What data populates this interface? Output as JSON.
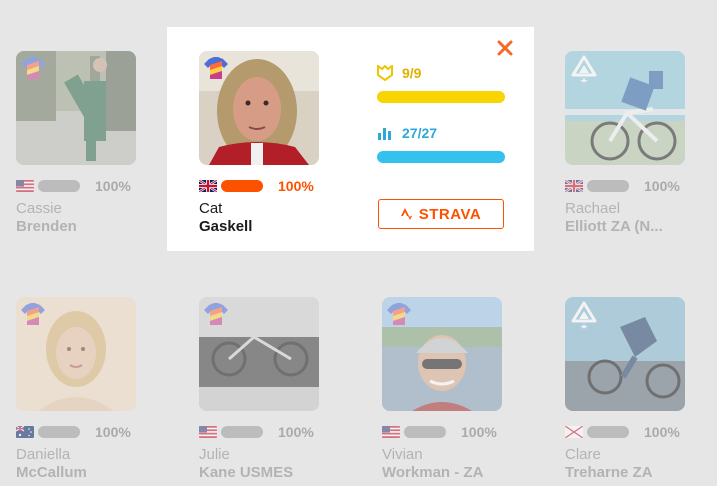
{
  "riders": [
    {
      "first": "Cassie",
      "last": "Brenden",
      "pct": "100%",
      "flag": "us-flag-icon",
      "badge": "jersey"
    },
    {
      "first": "Cat",
      "last": "Gaskell",
      "pct": "100%",
      "flag": "uk-flag-icon",
      "badge": "jersey"
    },
    {
      "first": "Rachael",
      "last": "Elliott ZA (N...",
      "pct": "100%",
      "flag": "uk-flag-icon",
      "badge": "triangle"
    },
    {
      "first": "Daniella",
      "last": "McCallum",
      "pct": "100%",
      "flag": "au-flag-icon",
      "badge": "jersey"
    },
    {
      "first": "Julie",
      "last": "Kane USMES",
      "pct": "100%",
      "flag": "us-flag-icon",
      "badge": "jersey"
    },
    {
      "first": "Vivian",
      "last": "Workman - ZA",
      "pct": "100%",
      "flag": "us-flag-icon",
      "badge": "jersey"
    },
    {
      "first": "Clare",
      "last": "Treharne ZA",
      "pct": "100%",
      "flag": "uk-flag-icon",
      "badge": "triangle"
    }
  ],
  "popup": {
    "workouts": "9/9",
    "stages": "27/27",
    "workouts_progress": 1.0,
    "stages_progress": 1.0,
    "strava_label": "STRAVA"
  },
  "colors": {
    "strava_orange": "#fc5200",
    "workouts_yellow": "#f9d500",
    "stages_blue": "#35c1ee",
    "background": "#e6e6e6"
  }
}
